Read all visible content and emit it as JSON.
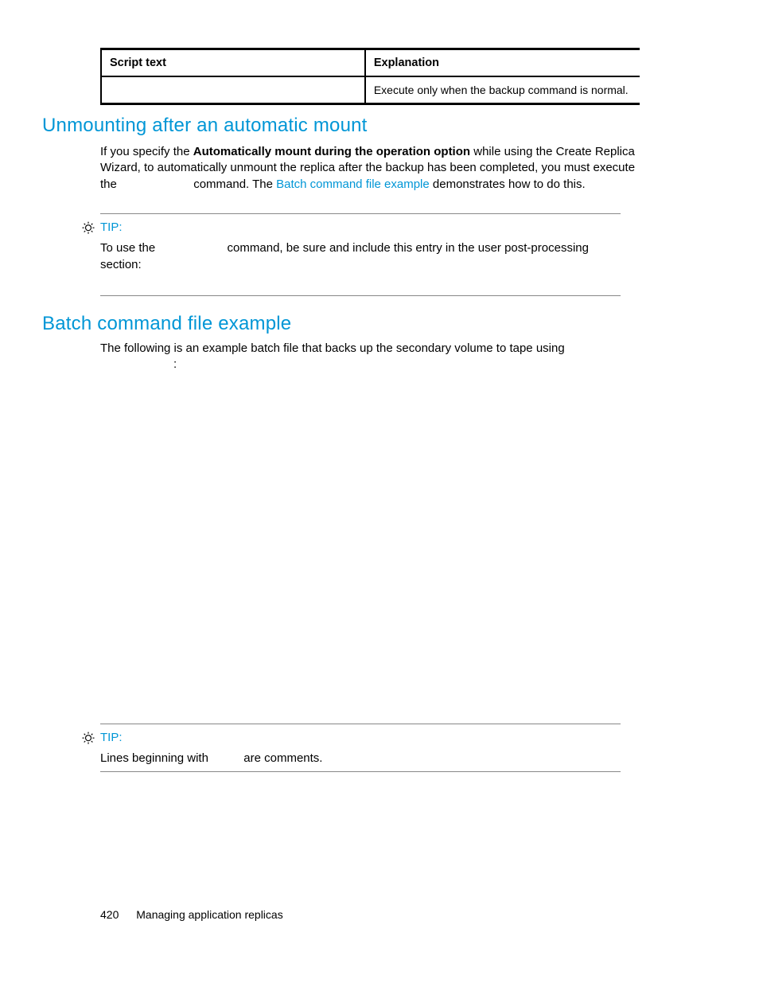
{
  "table": {
    "header": {
      "col1": "Script text",
      "col2": "Explanation"
    },
    "row": {
      "col1": "",
      "col2": "Execute only when the backup command is normal."
    }
  },
  "section1": {
    "heading": "Unmounting after an automatic mount",
    "para_before_bold": "If you specify the ",
    "para_bold": "Automatically mount during the operation option",
    "para_mid": " while using the Create Replica Wizard, to automatically unmount the replica after the backup has been completed, you must execute the ",
    "para_after_cmd": " command. The ",
    "link_text": "Batch command file example",
    "para_end": " demonstrates how to do this."
  },
  "tip1": {
    "label": "TIP:",
    "body_before": "To use the ",
    "body_after": " command, be sure and include this entry in the user post-processing section:"
  },
  "section2": {
    "heading": "Batch command file example",
    "para": "The following is an example batch file that backs up the secondary volume to tape using",
    "colon": ":"
  },
  "tip2": {
    "label": "TIP:",
    "body_before": "Lines beginning with ",
    "body_after": " are comments."
  },
  "footer": {
    "page_number": "420",
    "section": "Managing application replicas"
  }
}
